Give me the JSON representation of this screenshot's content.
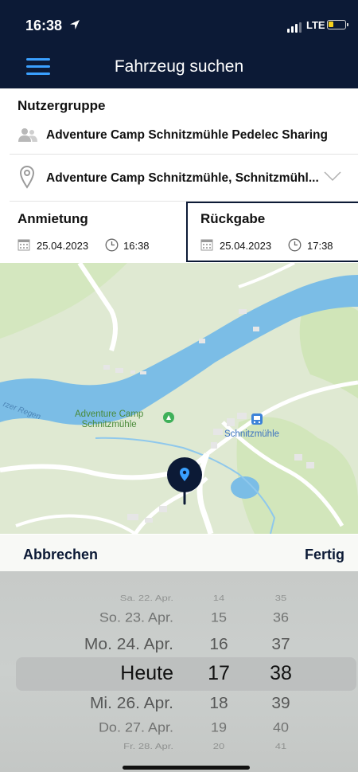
{
  "status_bar": {
    "time": "16:38",
    "network": "LTE"
  },
  "nav": {
    "title": "Fahrzeug suchen"
  },
  "user_group": {
    "label": "Nutzergruppe",
    "value": "Adventure Camp Schnitzmühle Pedelec Sharing"
  },
  "location": {
    "value": "Adventure Camp Schnitzmühle, Schnitzmühl..."
  },
  "rental": {
    "label": "Anmietung",
    "date": "25.04.2023",
    "time": "16:38"
  },
  "return": {
    "label": "Rückgabe",
    "date": "25.04.2023",
    "time": "17:38"
  },
  "map": {
    "river_label": "rzer Regen",
    "camp_label_line1": "Adventure Camp",
    "camp_label_line2": "Schnitzmühle",
    "station_label": "Schnitzmühle"
  },
  "toolbar": {
    "cancel": "Abbrechen",
    "done": "Fertig"
  },
  "picker": {
    "days": [
      "Sa. 22. Apr.",
      "So. 23. Apr.",
      "Mo. 24. Apr.",
      "Heute",
      "Mi. 26. Apr.",
      "Do. 27. Apr.",
      "Fr. 28. Apr."
    ],
    "hours": [
      "14",
      "15",
      "16",
      "17",
      "18",
      "19",
      "20"
    ],
    "minutes": [
      "35",
      "36",
      "37",
      "38",
      "39",
      "40",
      "41"
    ]
  }
}
